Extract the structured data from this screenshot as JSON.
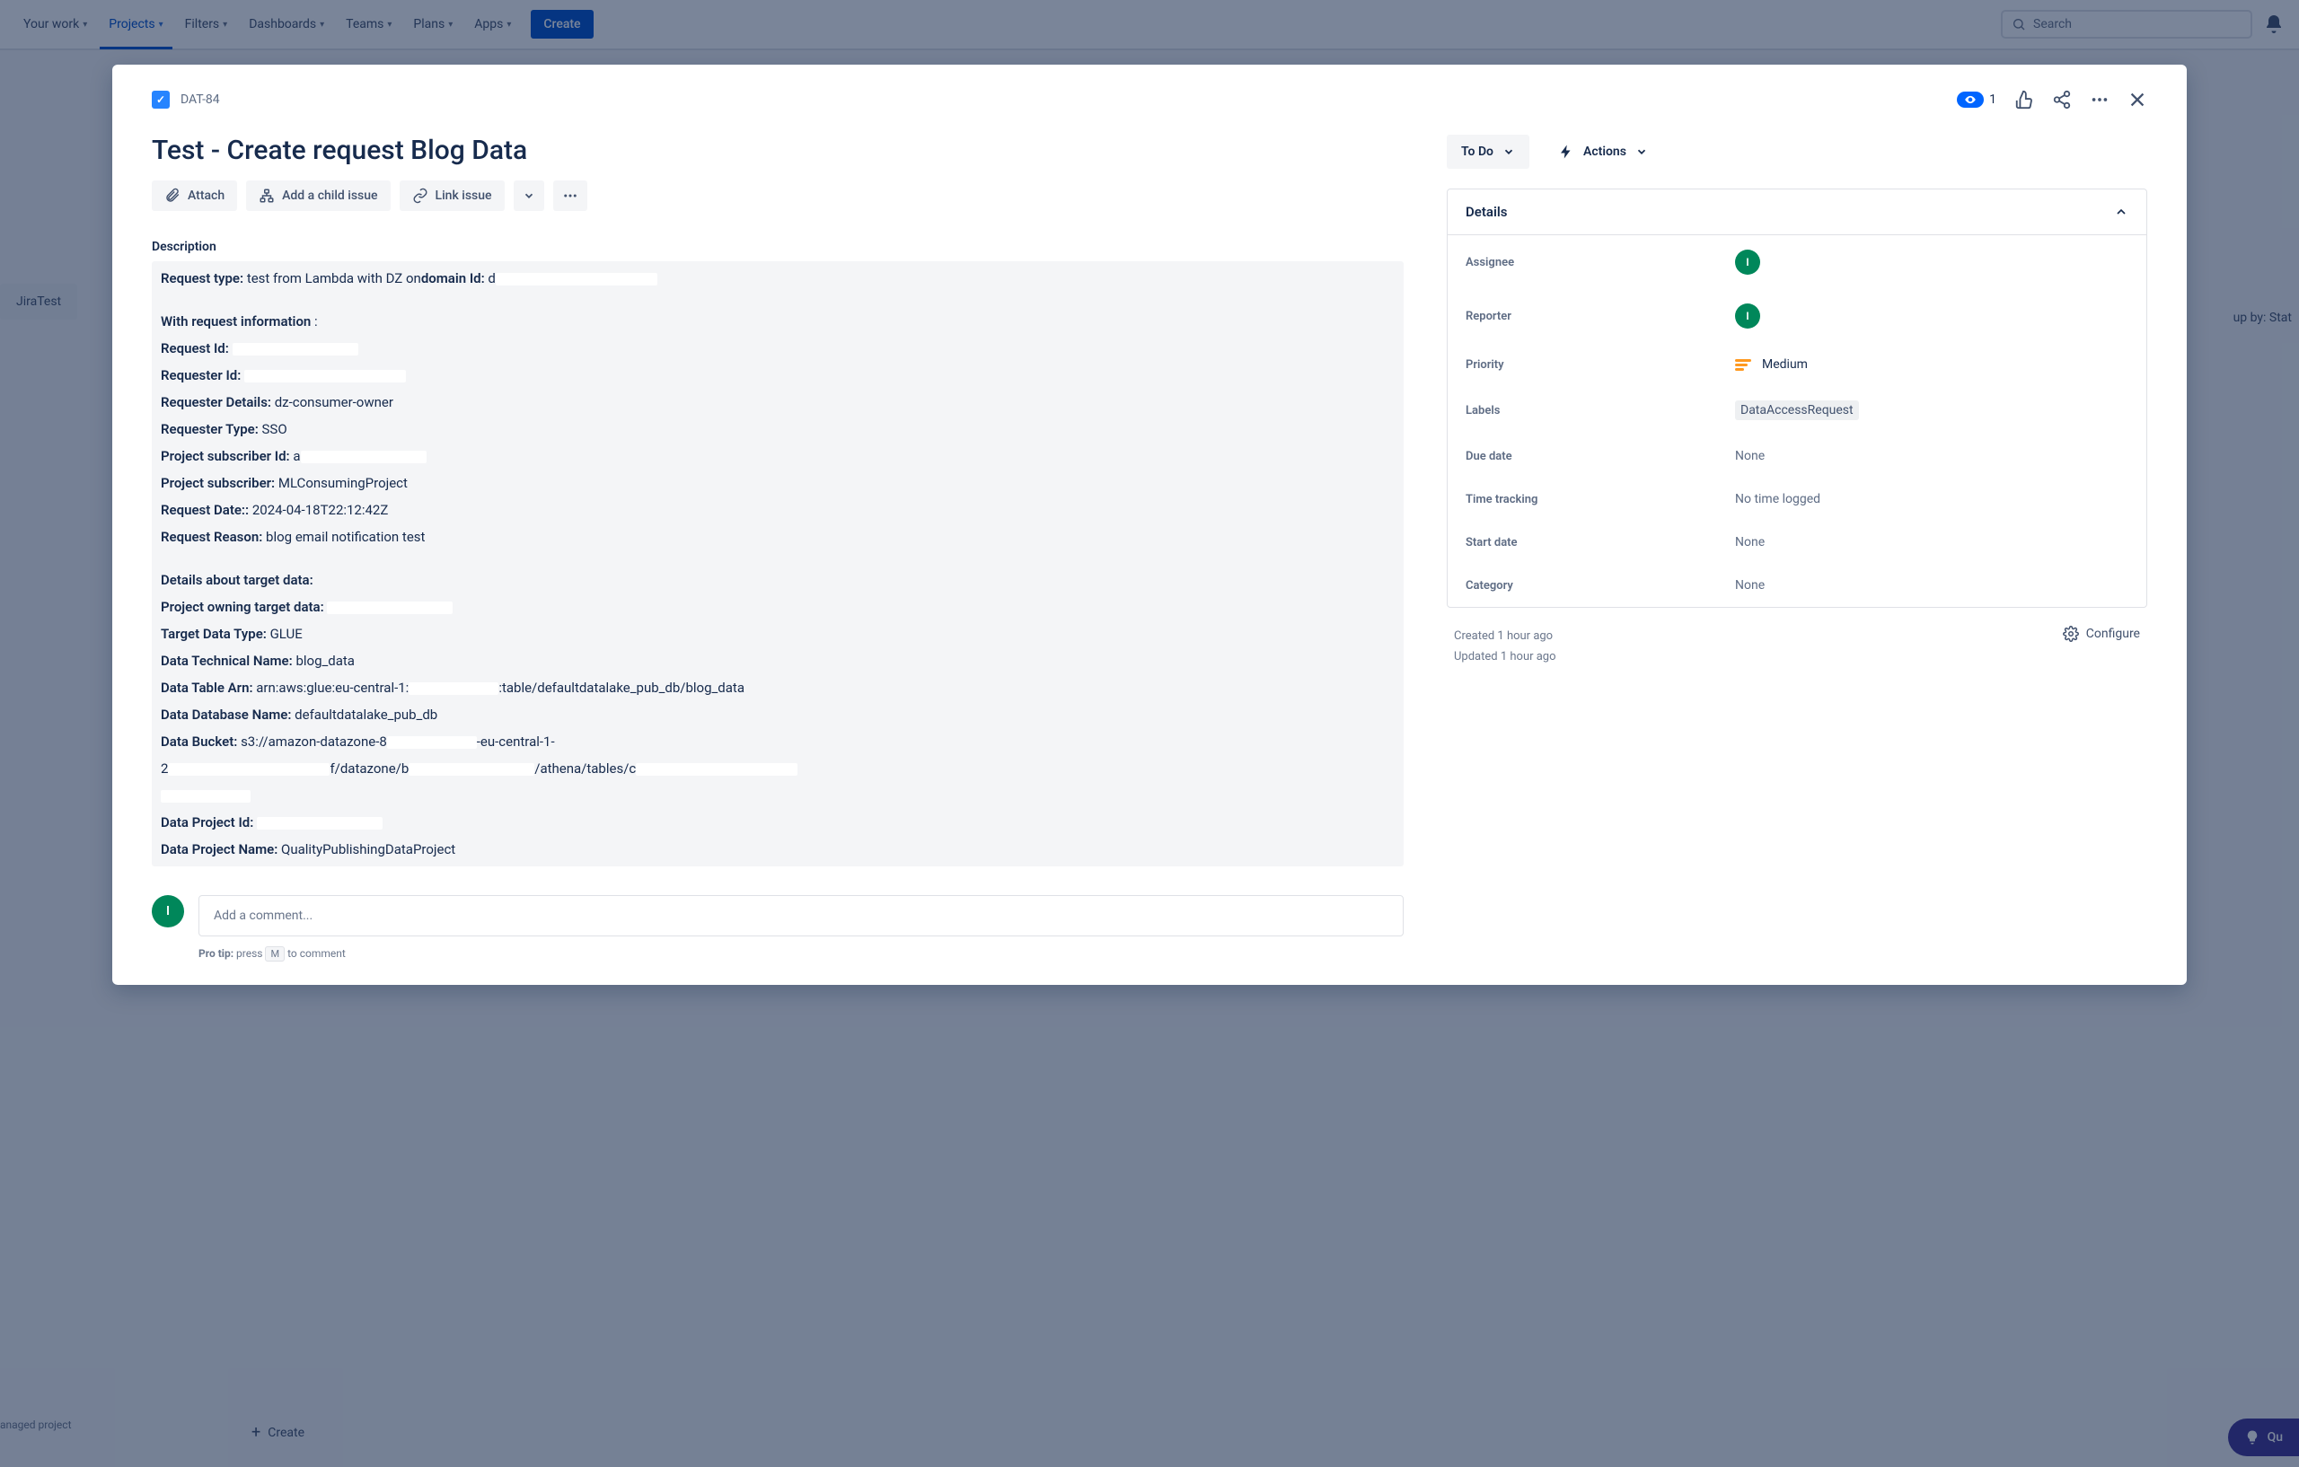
{
  "nav": {
    "your_work": "Your work",
    "projects": "Projects",
    "filters": "Filters",
    "dashboards": "Dashboards",
    "teams": "Teams",
    "plans": "Plans",
    "apps": "Apps",
    "create": "Create",
    "search_placeholder": "Search"
  },
  "board": {
    "left_tab": "JiraTest",
    "group_by": "up by: Stat",
    "managed": "anaged project",
    "create": "Create",
    "quick": "Qu"
  },
  "issue": {
    "key": "DAT-84",
    "watch_count": "1",
    "title": "Test - Create request Blog Data",
    "actions": {
      "attach": "Attach",
      "add_child": "Add a child issue",
      "link_issue": "Link issue"
    },
    "status": "To Do",
    "actions_label": "Actions",
    "description_label": "Description",
    "desc": {
      "request_type_label": "Request type:",
      "request_type_value": " test from Lambda with DZ on",
      "domain_id_label": "domain Id:",
      "domain_id_value": " d",
      "with_request_info": "With request information",
      "request_id_label": "Request Id:",
      "requester_id_label": "Requester Id:",
      "requester_details_label": "Requester Details:",
      "requester_details_value": " dz-consumer-owner",
      "requester_type_label": "Requester Type:",
      "requester_type_value": " SSO",
      "project_sub_id_label": "Project subscriber Id:",
      "project_sub_label": "Project subscriber:",
      "project_sub_value": " MLConsumingProject",
      "request_date_label": "Request Date::",
      "request_date_value": " 2024-04-18T22:12:42Z",
      "request_reason_label": "Request Reason:",
      "request_reason_value": " blog email notification test",
      "details_target_label": "Details about target data:",
      "project_owning_label": "Project owning target data:",
      "target_type_label": "Target Data Type:",
      "target_type_value": " GLUE",
      "tech_name_label": "Data Technical Name:",
      "tech_name_value": " blog_data",
      "table_arn_label": "Data Table Arn:",
      "table_arn_pre": " arn:aws:glue:eu-central-1:",
      "table_arn_post": ":table/defaultdatalake_pub_db/blog_data",
      "db_name_label": "Data Database Name:",
      "db_name_value": " defaultdatalake_pub_db",
      "bucket_label": "Data Bucket:",
      "bucket_pre": " s3://amazon-datazone-8",
      "bucket_mid": "-eu-central-1-",
      "bucket_path1": "f/datazone/b",
      "bucket_path2": "/athena/tables/c",
      "data_project_id_label": "Data Project Id:",
      "data_project_name_label": "Data Project Name:",
      "data_project_name_value": " QualityPublishingDataProject"
    },
    "comment_placeholder": "Add a comment...",
    "protip_label": "Pro tip:",
    "protip_press": " press ",
    "protip_key": "M",
    "protip_rest": " to comment"
  },
  "details": {
    "panel_title": "Details",
    "assignee_label": "Assignee",
    "reporter_label": "Reporter",
    "priority_label": "Priority",
    "priority_value": "Medium",
    "labels_label": "Labels",
    "labels_value": "DataAccessRequest",
    "due_date_label": "Due date",
    "due_date_value": "None",
    "time_tracking_label": "Time tracking",
    "time_tracking_value": "No time logged",
    "start_date_label": "Start date",
    "start_date_value": "None",
    "category_label": "Category",
    "category_value": "None",
    "created": "Created 1 hour ago",
    "updated": "Updated 1 hour ago",
    "configure": "Configure",
    "avatar_initial": "I"
  }
}
